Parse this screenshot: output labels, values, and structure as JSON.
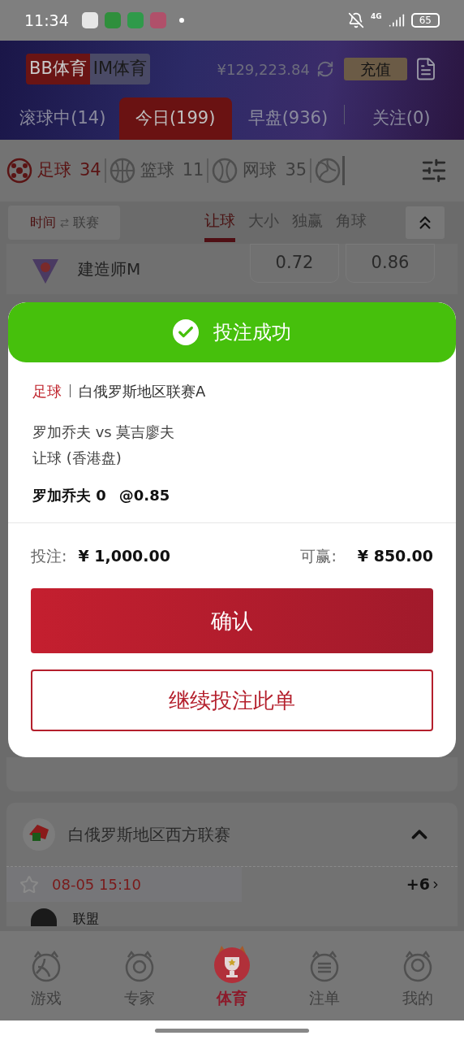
{
  "status_bar": {
    "time": "11:34",
    "network": "4G",
    "battery": "65"
  },
  "header": {
    "platforms": [
      {
        "label": "BB体育",
        "selected": true
      },
      {
        "label": "IM体育",
        "selected": false
      }
    ],
    "balance": "¥129,223.84",
    "deposit_button": "充值"
  },
  "period_tabs": [
    {
      "label": "滚球中(14)",
      "selected": false
    },
    {
      "label": "今日(199)",
      "selected": true
    },
    {
      "label": "早盘(936)",
      "selected": false
    },
    {
      "label": "关注(0)",
      "selected": false
    }
  ],
  "sport_tabs": [
    {
      "kind": "soccer",
      "label": "足球",
      "count": "34",
      "selected": true
    },
    {
      "kind": "basketball",
      "label": "篮球",
      "count": "11",
      "selected": false
    },
    {
      "kind": "tennis",
      "label": "网球",
      "count": "35",
      "selected": false
    },
    {
      "kind": "volleyball",
      "selected": false
    }
  ],
  "sort_toggle": {
    "left": "时间",
    "right": "联赛"
  },
  "market_tabs": [
    {
      "label": "让球",
      "selected": true
    },
    {
      "label": "大小",
      "selected": false
    },
    {
      "label": "独赢",
      "selected": false
    },
    {
      "label": "角球",
      "selected": false
    }
  ],
  "match_preview": {
    "team": "建造师M",
    "odds": [
      "0.72",
      "0.86"
    ]
  },
  "modal": {
    "title": "投注成功",
    "sport": "足球",
    "league": "白俄罗斯地区联赛A",
    "match": "罗加乔夫 vs 莫吉廖夫",
    "market": "让球 (香港盘)",
    "selection": "罗加乔夫 0",
    "odds": "@0.85",
    "stake_label": "投注:",
    "stake": "¥ 1,000.00",
    "win_label": "可赢:",
    "win": "¥ 850.00",
    "confirm_button": "确认",
    "continue_button": "继续投注此单"
  },
  "league": {
    "name": "白俄罗斯地区西方联赛",
    "expanded": true,
    "match_time": "08-05 15:10",
    "more": "+6",
    "team": "联盟"
  },
  "nav": [
    {
      "kind": "games",
      "label": "游戏",
      "selected": false
    },
    {
      "kind": "experts",
      "label": "专家",
      "selected": false
    },
    {
      "kind": "sports",
      "label": "体育",
      "selected": true
    },
    {
      "kind": "bets",
      "label": "注单",
      "selected": false
    },
    {
      "kind": "me",
      "label": "我的",
      "selected": false
    }
  ]
}
